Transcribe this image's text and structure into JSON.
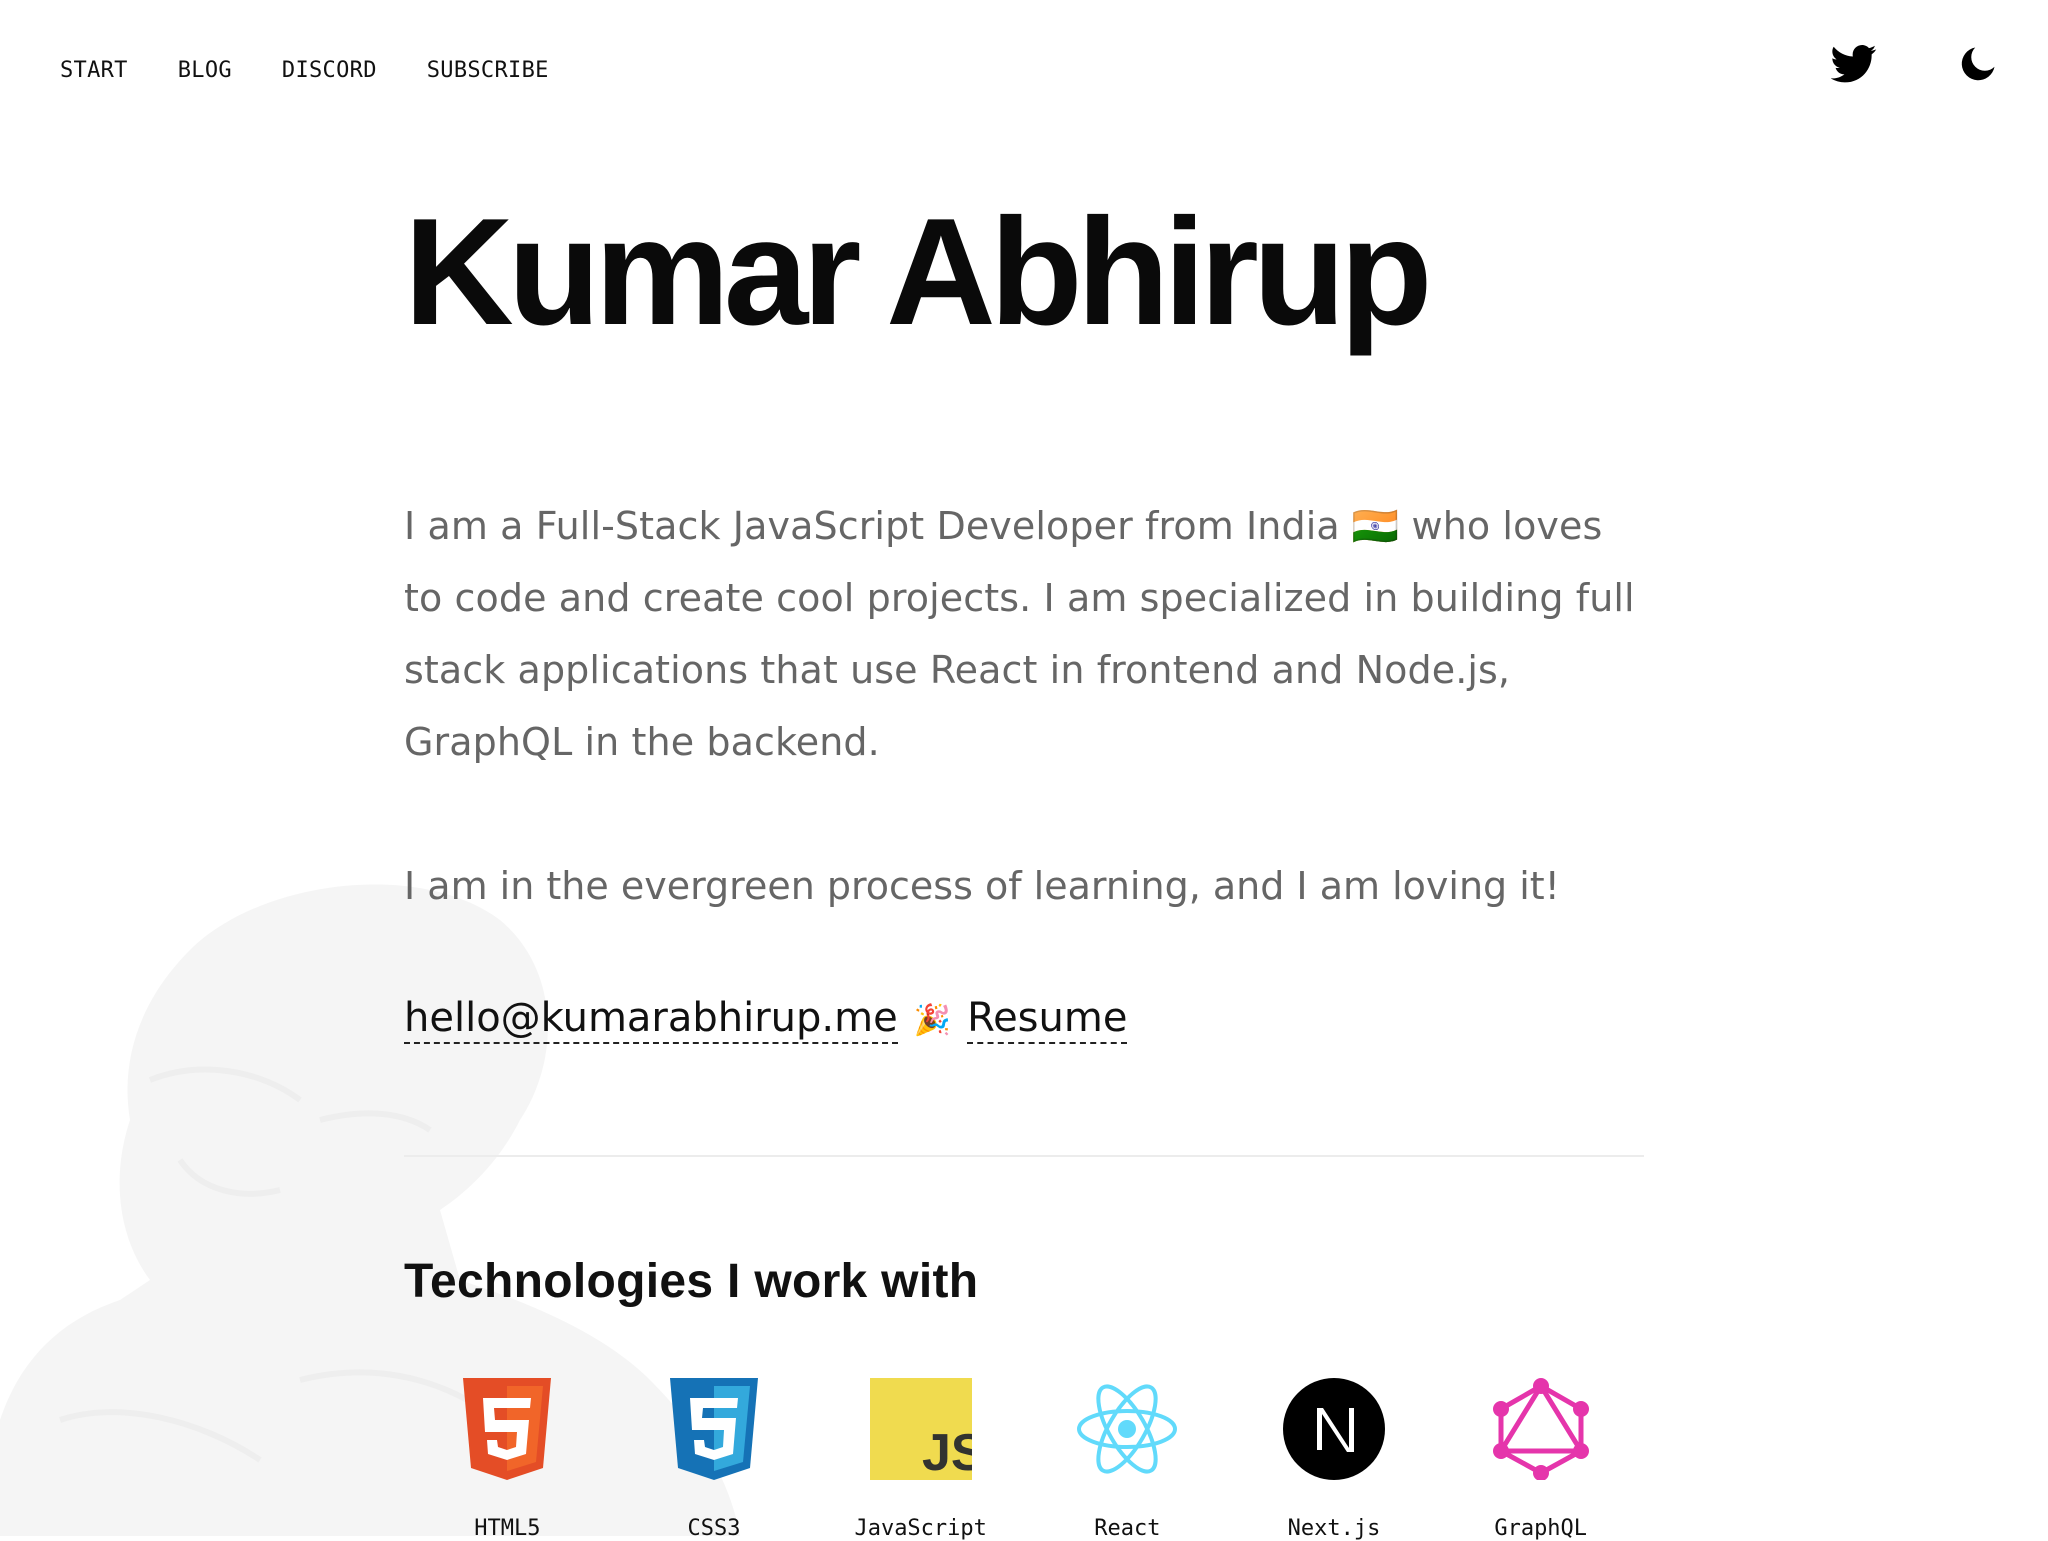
{
  "nav": {
    "items": [
      "START",
      "BLOG",
      "DISCORD",
      "SUBSCRIBE"
    ]
  },
  "icons": {
    "twitter": "twitter-icon",
    "theme_toggle": "moon-icon"
  },
  "hero": {
    "title": "Kumar Abhirup",
    "intro": "I am a Full-Stack JavaScript Developer from India 🇮🇳 who loves to code and create cool projects. I am specialized in building full stack applications that use React in frontend and Node.js, GraphQL in the backend.",
    "learning": "I am in the evergreen process of learning, and I am loving it!",
    "email": "hello@kumarabhirup.me",
    "separator": "🎉",
    "resume": "Resume"
  },
  "technologies": {
    "title": "Technologies I work with",
    "items": [
      {
        "label": "HTML5",
        "icon": "html5-icon",
        "color": "#E44D26"
      },
      {
        "label": "CSS3",
        "icon": "css3-icon",
        "color": "#1572B6"
      },
      {
        "label": "JavaScript",
        "icon": "javascript-icon",
        "color": "#F0DB4F"
      },
      {
        "label": "React",
        "icon": "react-icon",
        "color": "#61DAFB"
      },
      {
        "label": "Next.js",
        "icon": "nextjs-icon",
        "color": "#000000"
      },
      {
        "label": "GraphQL",
        "icon": "graphql-icon",
        "color": "#E535AB"
      }
    ]
  },
  "colors": {
    "text_primary": "#111111",
    "text_muted": "#666666",
    "divider": "#ECECEC"
  }
}
